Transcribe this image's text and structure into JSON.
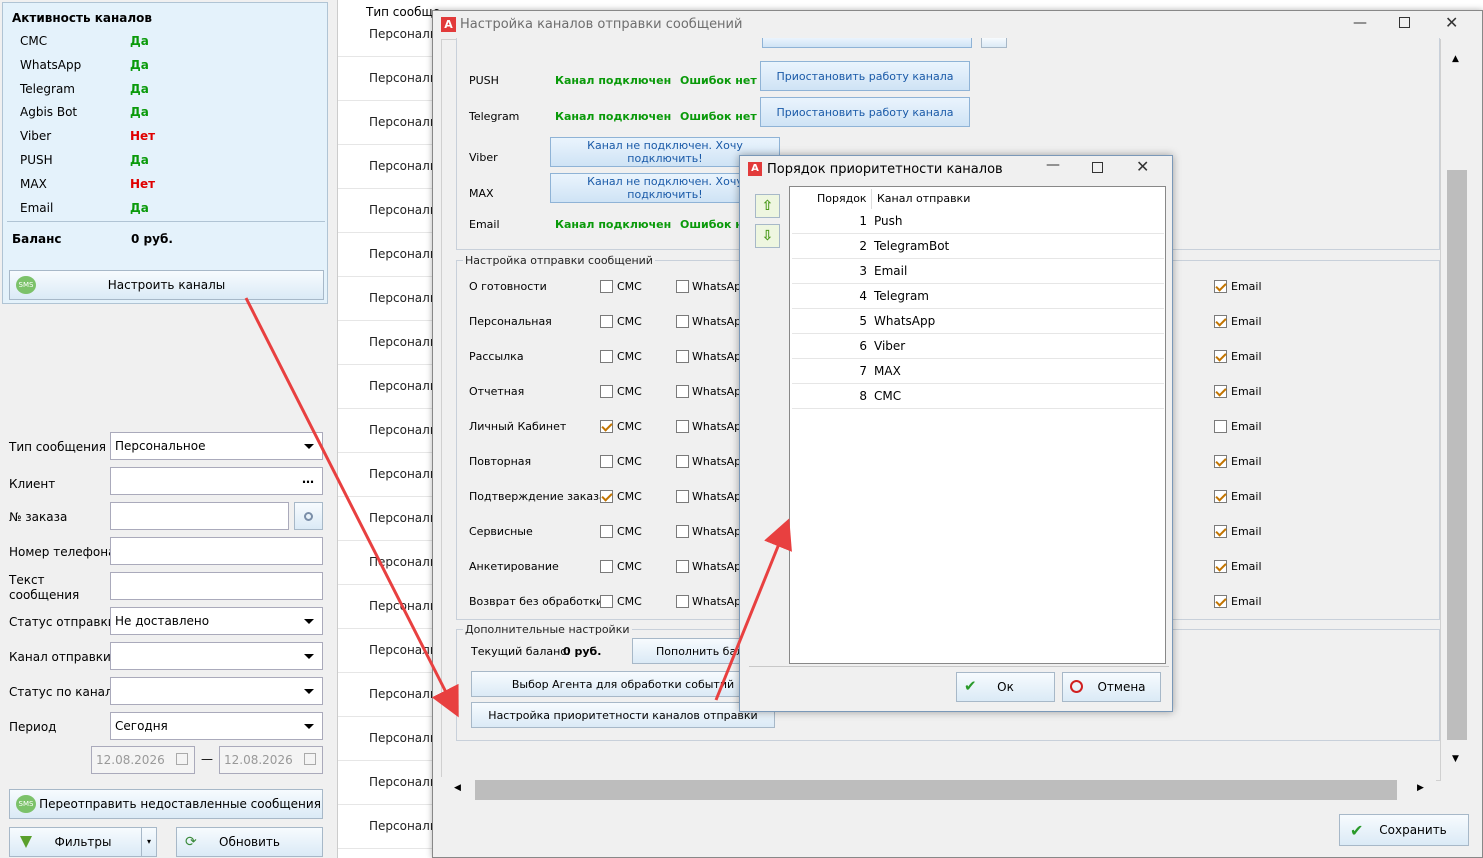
{
  "left_panel": {
    "activity_title": "Активность каналов",
    "channels": [
      {
        "name": "СМС",
        "status": "Да"
      },
      {
        "name": "WhatsApp",
        "status": "Да"
      },
      {
        "name": "Telegram",
        "status": "Да"
      },
      {
        "name": "Agbis Bot",
        "status": "Да"
      },
      {
        "name": "Viber",
        "status": "Нет"
      },
      {
        "name": "PUSH",
        "status": "Да"
      },
      {
        "name": "MAX",
        "status": "Нет"
      },
      {
        "name": "Email",
        "status": "Да"
      }
    ],
    "balance_label": "Баланс",
    "balance_value": "0 руб.",
    "configure_button": "Настроить каналы",
    "filters": {
      "message_type_label": "Тип сообщения",
      "message_type_value": "Персональное",
      "client_label": "Клиент",
      "order_label": "№ заказа",
      "phone_label": "Номер телефона",
      "text_label": "Текст сообщения",
      "send_status_label": "Статус отправки",
      "send_status_value": "Не доставлено",
      "channel_label": "Канал отправки",
      "channel_status_label": "Статус по каналу",
      "period_label": "Период",
      "period_value": "Сегодня",
      "date_from": "12.08.2026",
      "date_to": "12.08.2026",
      "date_sep": "—"
    },
    "resend_button": "Переотправить недоставленные сообщения",
    "filters_button": "Фильтры",
    "refresh_button": "Обновить"
  },
  "grid": {
    "header": "Тип сообще",
    "row_text": "Персональ"
  },
  "main_dialog": {
    "title": "Настройка каналов отправки сообщений",
    "channel_rows": [
      {
        "name": "PUSH",
        "state": "Канал подключен",
        "errors": "Ошибок нет",
        "action": "Приостановить работу канала"
      },
      {
        "name": "Telegram",
        "state": "Канал подключен",
        "errors": "Ошибок нет",
        "action": "Приостановить работу канала"
      },
      {
        "name": "Viber",
        "action": "Канал не подключен. Хочу подключить!"
      },
      {
        "name": "MAX",
        "action": "Канал не подключен. Хочу подключить!"
      },
      {
        "name": "Email",
        "state": "Канал подключен",
        "errors": "Ошибок нет"
      }
    ],
    "send_settings_title": "Настройка отправки сообщений",
    "msg_types": [
      {
        "name": "О готовности",
        "sms": false,
        "email": true
      },
      {
        "name": "Персональная",
        "sms": false,
        "email": true
      },
      {
        "name": "Рассылка",
        "sms": false,
        "email": true
      },
      {
        "name": "Отчетная",
        "sms": false,
        "email": true
      },
      {
        "name": "Личный Кабинет",
        "sms": true,
        "email": false
      },
      {
        "name": "Повторная",
        "sms": false,
        "email": true
      },
      {
        "name": "Подтверждение заказа",
        "sms": true,
        "email": true
      },
      {
        "name": "Сервисные",
        "sms": false,
        "email": true
      },
      {
        "name": "Анкетирование",
        "sms": false,
        "email": true
      },
      {
        "name": "Возврат без обработки",
        "sms": false,
        "email": true
      }
    ],
    "sms_label": "СМС",
    "whatsapp_label": "WhatsApp",
    "email_label": "Email",
    "extra_title": "Дополнительные настройки",
    "current_balance_label": "Текущий баланс:",
    "current_balance_value": "0 руб.",
    "topup_button": "Пополнить бала",
    "agent_button": "Выбор Агента для обработки событий",
    "priority_button": "Настройка приоритетности каналов отправки",
    "save_button": "Сохранить"
  },
  "priority_dialog": {
    "title": "Порядок приоритетности каналов",
    "col_order": "Порядок",
    "col_channel": "Канал отправки",
    "rows": [
      {
        "n": "1",
        "ch": "Push"
      },
      {
        "n": "2",
        "ch": "TelegramBot"
      },
      {
        "n": "3",
        "ch": "Email"
      },
      {
        "n": "4",
        "ch": "Telegram"
      },
      {
        "n": "5",
        "ch": "WhatsApp"
      },
      {
        "n": "6",
        "ch": "Viber"
      },
      {
        "n": "7",
        "ch": "MAX"
      },
      {
        "n": "8",
        "ch": "СМС"
      }
    ],
    "ok_button": "Ок",
    "cancel_button": "Отмена"
  },
  "colors": {
    "yes": "#0a9a0a",
    "no": "#e00000",
    "arrow": "#e84040",
    "accent": "#1a5aa8"
  }
}
